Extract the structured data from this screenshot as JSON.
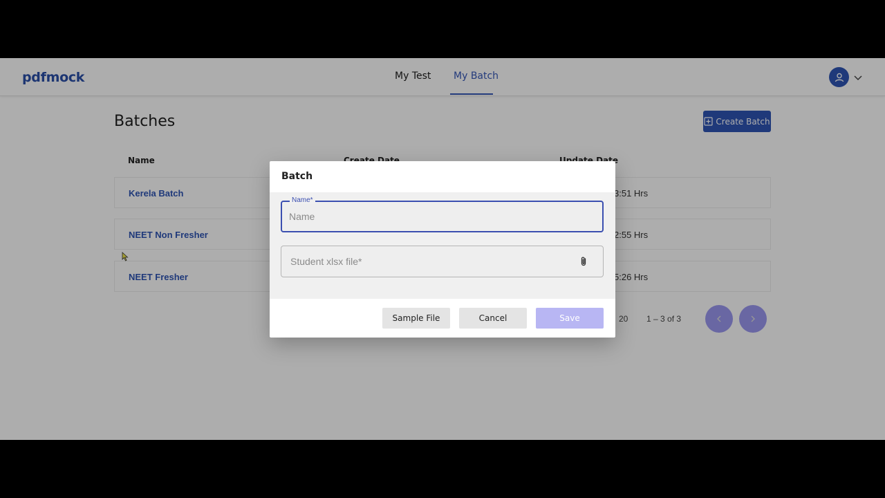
{
  "header": {
    "logo": "pdfmock",
    "tabs": [
      {
        "label": "My Test"
      },
      {
        "label": "My Batch"
      }
    ]
  },
  "page": {
    "title": "Batches",
    "create_button": "Create Batch"
  },
  "table": {
    "columns": [
      "Name",
      "Create Date",
      "Update Date"
    ],
    "rows": [
      {
        "name": "Kerela Batch",
        "update": "3:51 Hrs"
      },
      {
        "name": "NEET Non Fresher",
        "update": "2:55 Hrs"
      },
      {
        "name": "NEET Fresher",
        "update": "5:26 Hrs"
      }
    ]
  },
  "pagination": {
    "page_size": "20",
    "range": "1 – 3 of 3"
  },
  "dialog": {
    "title": "Batch",
    "name_label": "Name*",
    "name_placeholder": "Name",
    "name_value": "",
    "file_label": "Student xlsx file*",
    "buttons": {
      "sample": "Sample File",
      "cancel": "Cancel",
      "save": "Save"
    }
  },
  "colors": {
    "brand": "#2f55b4",
    "focus": "#3b4fb0",
    "save_disabled": "#b8b6f3"
  },
  "icons": [
    "user-icon",
    "chevron-down-icon",
    "plus-square-icon",
    "paperclip-icon",
    "chevron-left-icon",
    "chevron-right-icon"
  ]
}
